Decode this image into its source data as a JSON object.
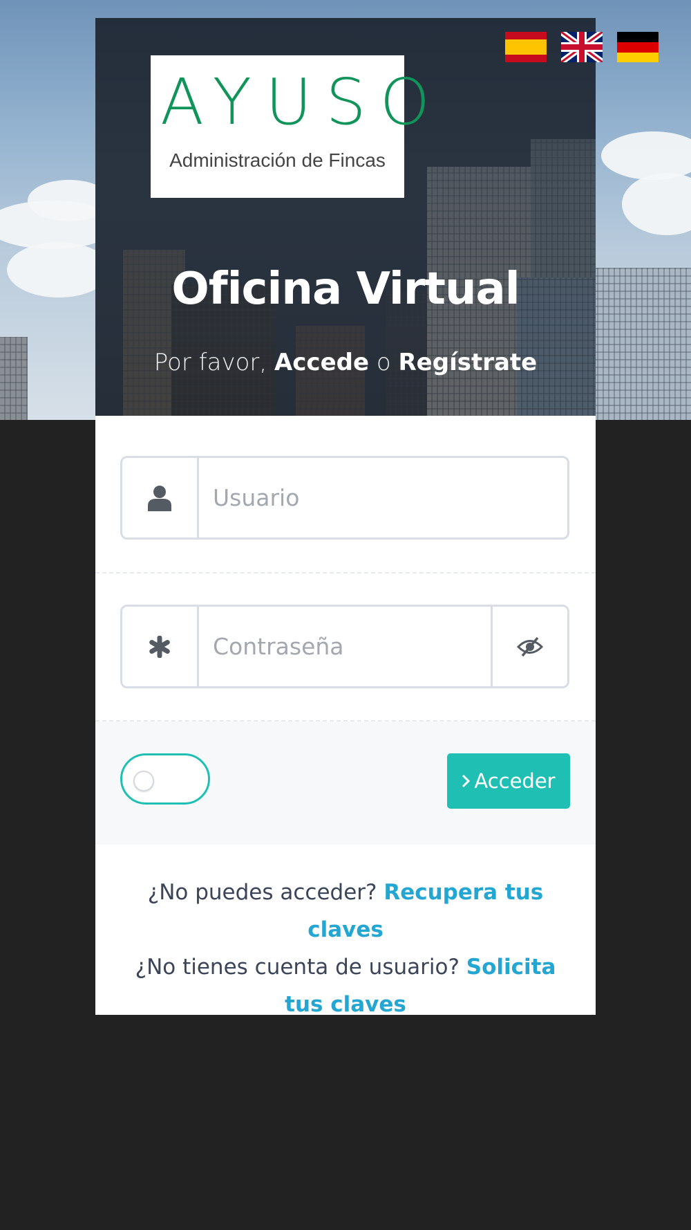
{
  "languages": [
    {
      "name": "Español",
      "icon": "flag-es-icon"
    },
    {
      "name": "English",
      "icon": "flag-gb-icon"
    },
    {
      "name": "Deutsch",
      "icon": "flag-de-icon"
    }
  ],
  "logo": {
    "word": "AYUSO",
    "subtitle": "Administración de Fincas"
  },
  "header": {
    "title": "Oficina Virtual",
    "prompt_prefix": "Por favor, ",
    "login_link": "Accede",
    "prompt_or": " o ",
    "register_link": "Regístrate"
  },
  "form": {
    "username": {
      "placeholder": "Usuario",
      "value": "",
      "icon": "user-icon"
    },
    "password": {
      "placeholder": "Contraseña",
      "value": "",
      "icon": "asterisk-icon",
      "toggle_icon": "eye-slash-icon"
    },
    "remember_toggle": {
      "checked": false
    },
    "submit": {
      "label": "Acceder",
      "icon": "chevron-right-icon"
    }
  },
  "help": {
    "forgot_text": "¿No puedes acceder? ",
    "forgot_link": "Recupera tus claves",
    "no_account_text": "¿No tienes cuenta de usuario? ",
    "request_link": "Solicita tus claves"
  },
  "colors": {
    "accent": "#1fc0b3",
    "link": "#24a6d3",
    "logo_green": "#10945a",
    "page_bg": "#222222"
  }
}
